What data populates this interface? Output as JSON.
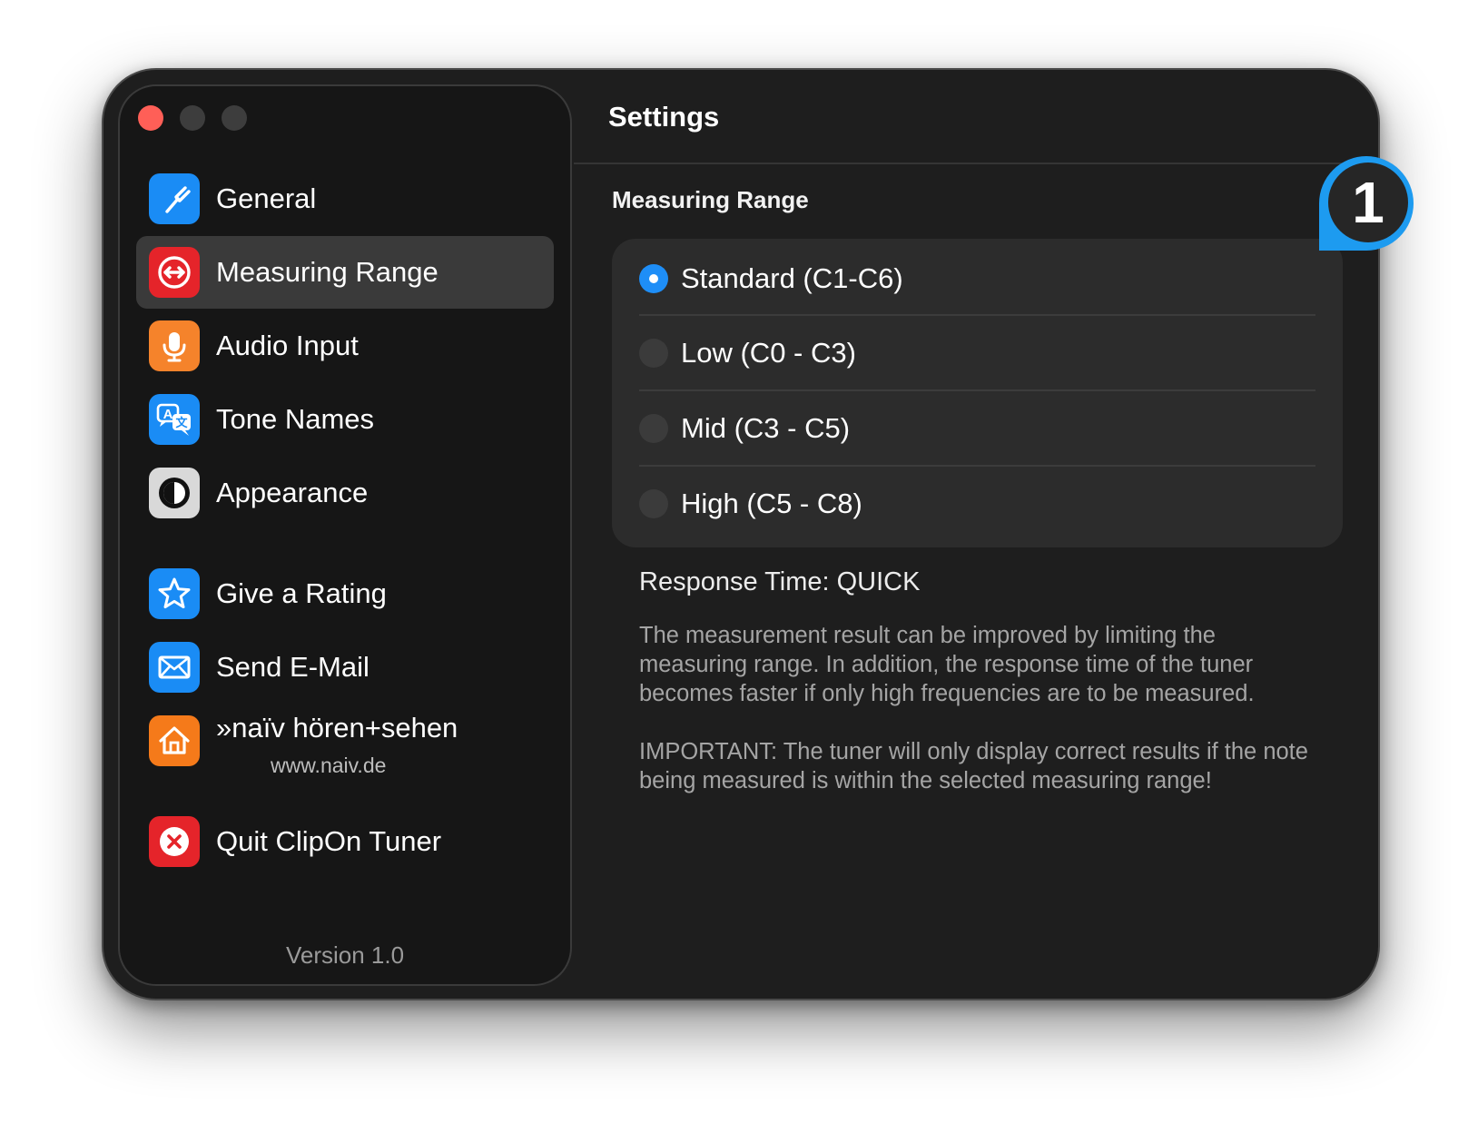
{
  "window": {
    "title": "Settings"
  },
  "sidebar": {
    "items": [
      {
        "label": "General",
        "icon": "tuning-fork-icon",
        "color": "#1a8cf5",
        "active": false
      },
      {
        "label": "Measuring Range",
        "icon": "range-arrows-icon",
        "color": "#e5242a",
        "active": true
      },
      {
        "label": "Audio Input",
        "icon": "microphone-icon",
        "color": "#f5832b",
        "active": false
      },
      {
        "label": "Tone Names",
        "icon": "translate-icon",
        "color": "#1a8cf5",
        "active": false
      },
      {
        "label": "Appearance",
        "icon": "contrast-icon",
        "color": "#d9d9d9",
        "active": false
      },
      {
        "label": "Give a Rating",
        "icon": "star-icon",
        "color": "#1a8cf5",
        "active": false
      },
      {
        "label": "Send E-Mail",
        "icon": "envelope-icon",
        "color": "#1a8cf5",
        "active": false
      },
      {
        "label": "»naïv hören+sehen",
        "sublabel": "www.naiv.de",
        "icon": "house-icon",
        "color": "#f57a1a",
        "active": false
      },
      {
        "label": "Quit ClipOn Tuner",
        "icon": "close-circle-icon",
        "color": "#e5242a",
        "active": false
      }
    ],
    "version": "Version 1.0"
  },
  "main": {
    "section_title": "Measuring Range",
    "options": [
      {
        "label": "Standard (C1-C6)",
        "selected": true
      },
      {
        "label": "Low (C0 - C3)",
        "selected": false
      },
      {
        "label": "Mid (C3 - C5)",
        "selected": false
      },
      {
        "label": "High (C5 - C8)",
        "selected": false
      }
    ],
    "response_time": "Response Time: QUICK",
    "description": "The measurement result can be improved by limiting the measuring range. In addition, the response time of the tuner becomes faster if only high frequencies are to be measured.",
    "important": "IMPORTANT: The tuner will only display correct results if the note being measured is within the selected measuring range!"
  },
  "callout": {
    "number": "1",
    "color": "#1d9bf0"
  },
  "colors": {
    "accent": "#1e8ef7",
    "close": "#ff5f57"
  }
}
